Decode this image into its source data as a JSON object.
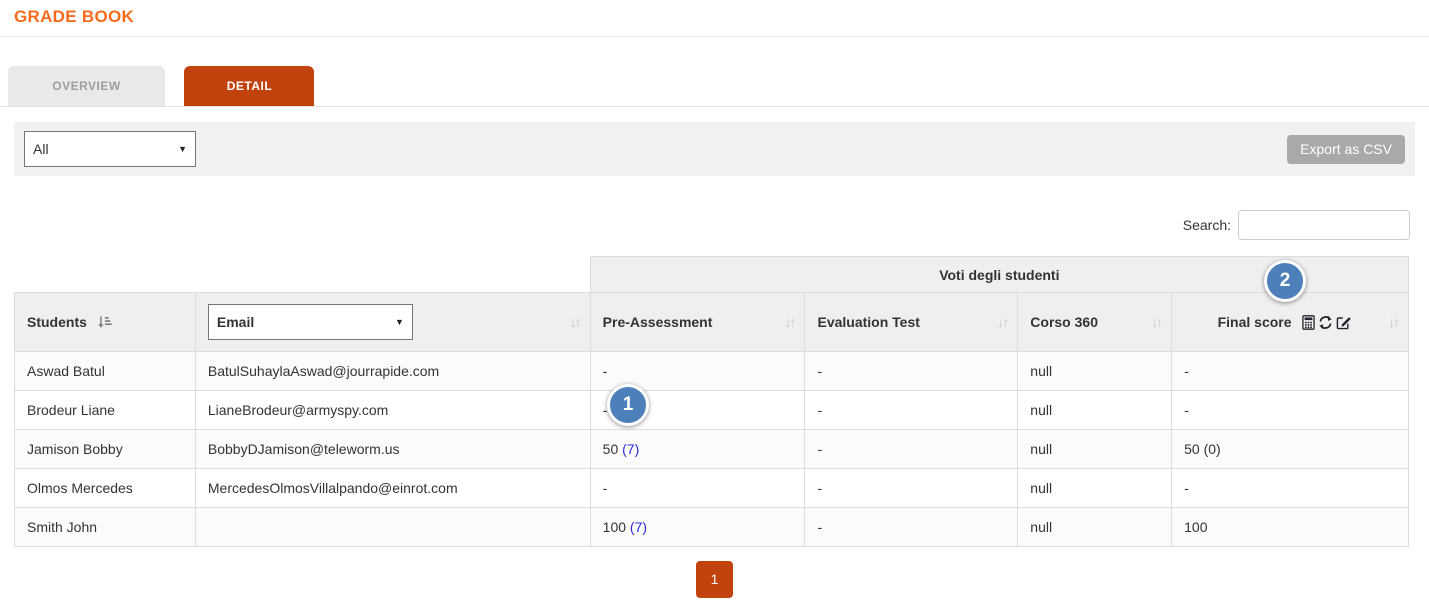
{
  "page": {
    "title": "GRADE BOOK"
  },
  "tabs": {
    "overview_label": "OVERVIEW",
    "detail_label": "DETAIL",
    "active_tab": "DETAIL"
  },
  "filter": {
    "course_dropdown_value": "All",
    "export_button_label": "Export as CSV"
  },
  "search": {
    "label": "Search:",
    "value": ""
  },
  "table": {
    "group_header": "Voti degli studenti",
    "columns": {
      "students": "Students",
      "email_dropdown_value": "Email",
      "pre_assessment": "Pre-Assessment",
      "evaluation_test": "Evaluation Test",
      "corso_360": "Corso 360",
      "final_score": "Final score"
    },
    "final_score_icon_names": [
      "calculator-icon",
      "refresh-icon",
      "edit-icon"
    ],
    "rows": [
      {
        "student": "Aswad Batul",
        "email": "BatulSuhaylaAswad@jourrapide.com",
        "pre": "-",
        "pre_link": "",
        "eval": "-",
        "corso": "null",
        "final": "-"
      },
      {
        "student": "Brodeur Liane",
        "email": "LianeBrodeur@armyspy.com",
        "pre": "-",
        "pre_link": "",
        "eval": "-",
        "corso": "null",
        "final": "-"
      },
      {
        "student": "Jamison Bobby",
        "email": "BobbyDJamison@teleworm.us",
        "pre": "50",
        "pre_link": "(7)",
        "eval": "-",
        "corso": "null",
        "final": "50 (0)"
      },
      {
        "student": "Olmos Mercedes",
        "email": "MercedesOlmosVillalpando@einrot.com",
        "pre": "-",
        "pre_link": "",
        "eval": "-",
        "corso": "null",
        "final": "-"
      },
      {
        "student": "Smith John",
        "email": "",
        "pre": "100",
        "pre_link": "(7)",
        "eval": "-",
        "corso": "null",
        "final": "100"
      }
    ]
  },
  "badges": [
    {
      "number": "1"
    },
    {
      "number": "2"
    }
  ],
  "pagination": {
    "current_page": "1"
  },
  "colors": {
    "title_orange": "#f76b1c",
    "active_tab_orange": "#c2420d",
    "badge_blue": "#4d80bb",
    "link_blue": "#2b2bd5",
    "header_gray": "#efefef"
  }
}
